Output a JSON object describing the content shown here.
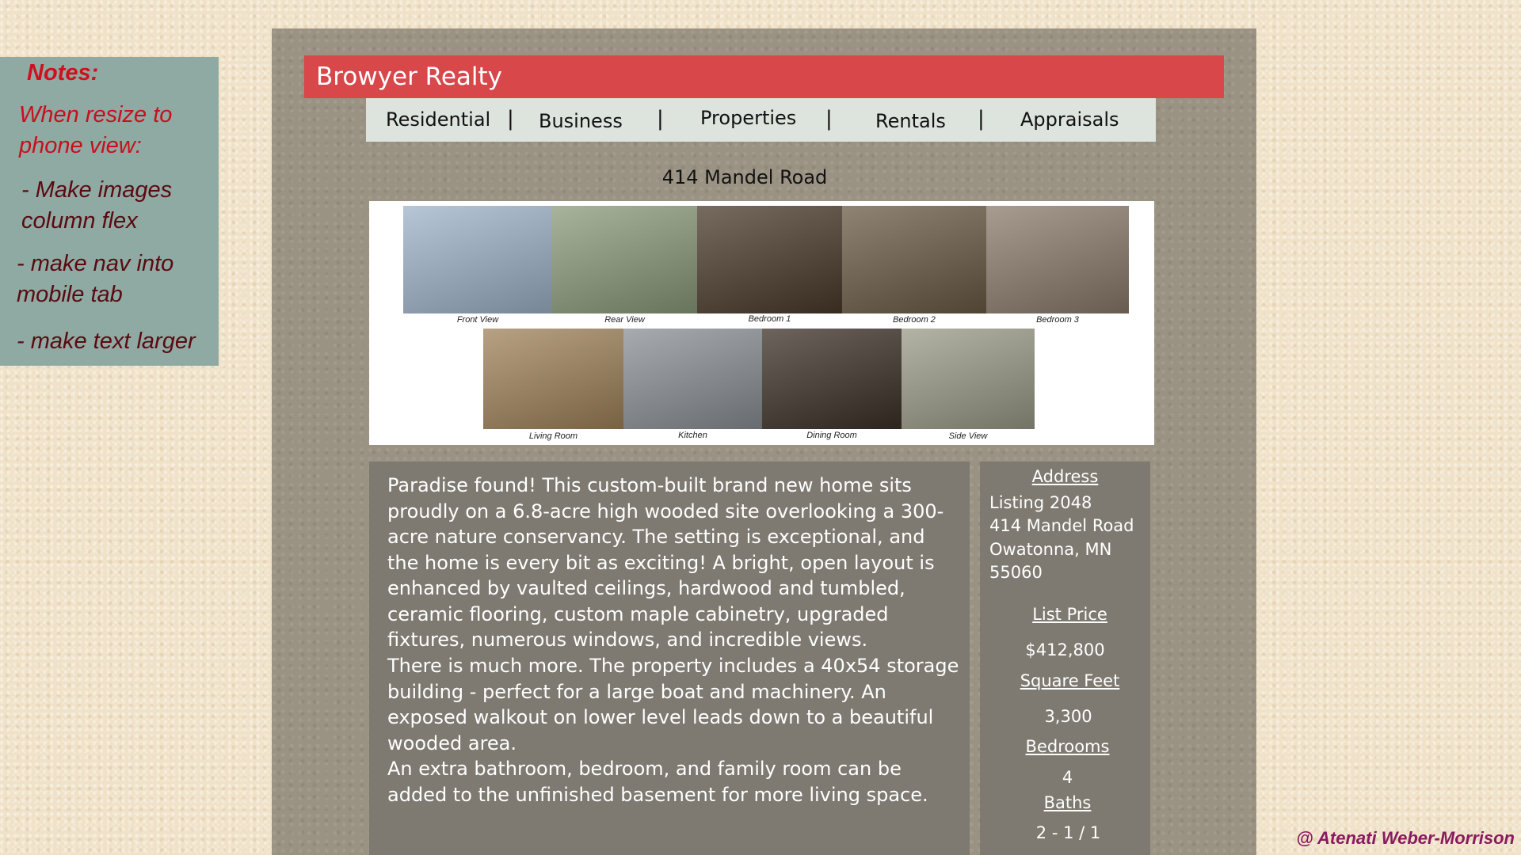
{
  "notes": {
    "title": "Notes:",
    "subtitle": "When resize to phone view:",
    "items": [
      "- Make images column flex",
      "- make nav into mobile tab",
      "- make text larger"
    ]
  },
  "header": {
    "title": "Browyer Realty"
  },
  "nav": {
    "items": [
      "Residential",
      "Business",
      "Properties",
      "Rentals",
      "Appraisals"
    ],
    "separator": "|"
  },
  "listing": {
    "heading": "414 Mandel Road",
    "photos": [
      {
        "caption": "Front View",
        "color": "#9fb3c9"
      },
      {
        "caption": "Rear View",
        "color": "#8a9a7a"
      },
      {
        "caption": "Bedroom 1",
        "color": "#4a3a2a"
      },
      {
        "caption": "Bedroom 2",
        "color": "#6a5a45"
      },
      {
        "caption": "Bedroom 3",
        "color": "#8b7a6a"
      },
      {
        "caption": "Living Room",
        "color": "#a0825a"
      },
      {
        "caption": "Kitchen",
        "color": "#8a8f94"
      },
      {
        "caption": "Dining Room",
        "color": "#3d3028"
      },
      {
        "caption": "Side View",
        "color": "#9a9a88"
      }
    ],
    "description": [
      "Paradise found! This custom-built brand new home sits proudly on a 6.8-acre high wooded site overlooking a 300-acre nature conservancy. The setting is exceptional, and the home is every bit as exciting! A bright, open layout is enhanced by vaulted ceilings, hardwood and tumbled, ceramic flooring, custom maple cabinetry, upgraded fixtures, numerous windows, and incredible views.",
      "There is much more. The property includes a 40x54 storage building - perfect for a large boat and machinery. An exposed walkout on lower level leads down to a beautiful wooded area.",
      "An extra bathroom, bedroom, and family room can be added to the unfinished basement for more living space."
    ],
    "facts": {
      "address_label": "Address",
      "address_lines": [
        "Listing 2048",
        "414 Mandel Road",
        "Owatonna, MN",
        "55060"
      ],
      "price_label": "List Price",
      "price": "$412,800",
      "sqft_label": "Square Feet",
      "sqft": "3,300",
      "bedrooms_label": "Bedrooms",
      "bedrooms": "4",
      "baths_label": "Baths",
      "baths": "2 - 1 / 1"
    }
  },
  "credit": "@ Atenati Weber-Morrison"
}
